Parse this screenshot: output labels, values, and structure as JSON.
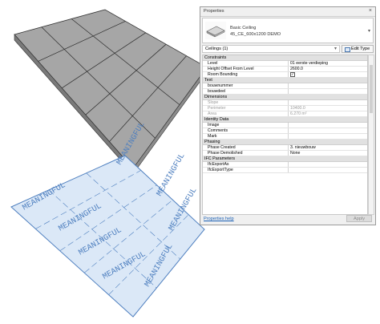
{
  "properties_panel": {
    "title": "Properties",
    "type_name": "Basic Ceiling",
    "type_subname": "45_CE_600x1200 DEMO",
    "instance_selector": "Ceilings (1)",
    "edit_type_label": "Edit Type",
    "help_link": "Properties help",
    "apply_label": "Apply"
  },
  "groups": [
    {
      "name": "Constraints",
      "params": [
        {
          "name": "Level",
          "value": "01 eerste verdieping"
        },
        {
          "name": "Height Offset From Level",
          "value": "2600.0"
        },
        {
          "name": "Room Bounding",
          "value": "",
          "checkbox": true,
          "checked": true
        }
      ]
    },
    {
      "name": "Text",
      "params": [
        {
          "name": "bouwnummer",
          "value": ""
        },
        {
          "name": "bouwdeel",
          "value": ""
        }
      ]
    },
    {
      "name": "Dimensions",
      "params": [
        {
          "name": "Slope",
          "value": "",
          "readonly": true
        },
        {
          "name": "Perimeter",
          "value": "10400.0",
          "readonly": true
        },
        {
          "name": "Area",
          "value": "6.270 m²",
          "readonly": true
        }
      ]
    },
    {
      "name": "Identity Data",
      "params": [
        {
          "name": "Image",
          "value": ""
        },
        {
          "name": "Comments",
          "value": ""
        },
        {
          "name": "Mark",
          "value": ""
        }
      ]
    },
    {
      "name": "Phasing",
      "params": [
        {
          "name": "Phase Created",
          "value": "3. nieuwbouw"
        },
        {
          "name": "Phase Demolished",
          "value": "None"
        }
      ]
    },
    {
      "name": "IFC Parameters",
      "params": [
        {
          "name": "IfcExportAs",
          "value": ""
        },
        {
          "name": "IfcExportType",
          "value": ""
        }
      ]
    }
  ],
  "viewport": {
    "ceiling_fill": "#a6a6a6",
    "ceiling_edge": "#333333",
    "plan_fill": "#dbe8f7",
    "plan_line": "#4e7fbf",
    "plan_watermark": "MEANINGFUL"
  }
}
